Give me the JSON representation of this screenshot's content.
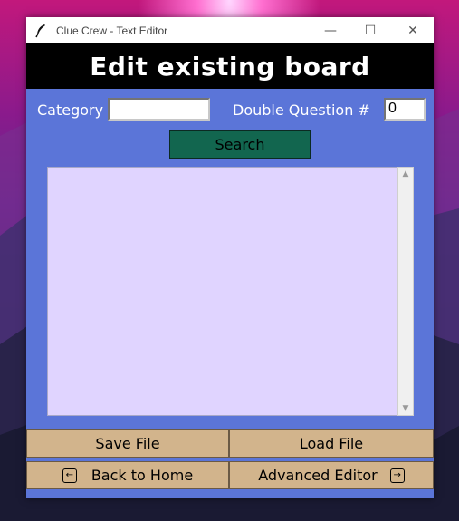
{
  "window": {
    "title": "Clue Crew - Text Editor",
    "controls": {
      "minimize": "—",
      "maximize": "☐",
      "close": "✕"
    }
  },
  "header": {
    "title": "Edit existing board"
  },
  "form": {
    "category_label": "Category",
    "category_value": "",
    "double_question_label": "Double Question #",
    "double_question_value": "0",
    "search_label": "Search"
  },
  "editor": {
    "content": ""
  },
  "buttons": {
    "save_file": "Save File",
    "load_file": "Load File",
    "back_to_home": "Back to Home",
    "advanced_editor": "Advanced Editor"
  },
  "icons": {
    "app": "feather-icon",
    "back": "arrow-left-box-icon",
    "forward": "arrow-right-box-icon"
  },
  "colors": {
    "window_bg": "#5b75d8",
    "header_bg": "#000000",
    "search_bg": "#12664f",
    "text_area_bg": "#e0d4ff",
    "button_bg": "#d2b48c"
  }
}
